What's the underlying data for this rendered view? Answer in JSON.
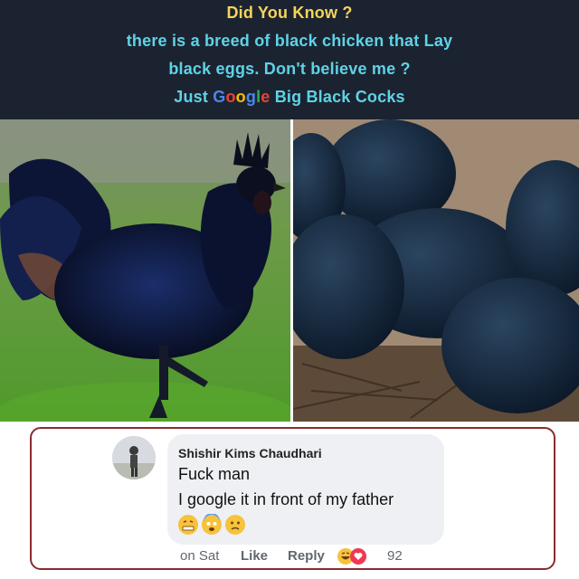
{
  "caption": {
    "line1": "Did You Know ?",
    "line2": "there is a breed of black chicken that Lay",
    "line3": "black eggs. Don't believe me ?",
    "line4_prefix": "Just",
    "line4_google": [
      "G",
      "o",
      "o",
      "g",
      "l",
      "e"
    ],
    "line4_suffix": "Big Black Cocks",
    "colors": {
      "heading": "#f4d55a",
      "body": "#5ed3e6",
      "background": "#1c2330"
    }
  },
  "photos": {
    "left": "black-rooster-icon",
    "right": "black-eggs-icon"
  },
  "comment": {
    "author": "Shishir Kims Chaudhari",
    "text_line1": "Fuck man",
    "text_line2": "I google it in front of my father",
    "emojis": [
      "grimacing-sweat-emoji",
      "scared-emoji",
      "worried-emoji"
    ],
    "time": "on Sat",
    "like": "Like",
    "reply": "Reply",
    "reactions": [
      "haha-reaction-icon",
      "love-reaction-icon"
    ],
    "reaction_count": "92",
    "colors": {
      "frame": "#8a2b2e",
      "bubble": "#eef0f3"
    }
  }
}
